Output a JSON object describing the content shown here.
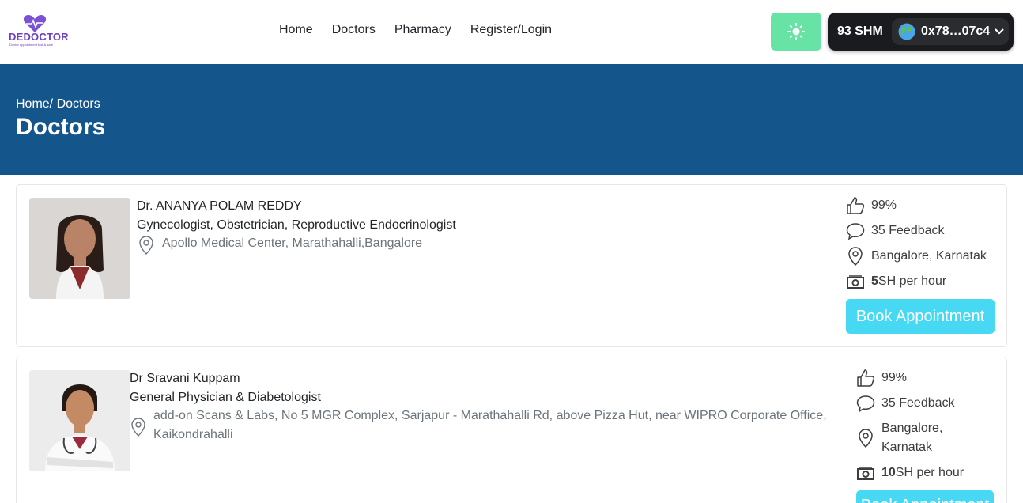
{
  "brand": {
    "name": "DEDOCTOR",
    "tagline": "Doctor appointment fast & safe",
    "accent": "#6b3fc4"
  },
  "nav": {
    "items": [
      {
        "label": "Home"
      },
      {
        "label": "Doctors"
      },
      {
        "label": "Pharmacy"
      },
      {
        "label": "Register/Login"
      }
    ]
  },
  "theme_toggle": {
    "icon": "sun-icon",
    "color": "#66e3a5"
  },
  "wallet": {
    "balance": "93 SHM",
    "address": "0x78…07c4",
    "icon": "globe-icon"
  },
  "hero": {
    "breadcrumb_home": "Home/",
    "breadcrumb_current": " Doctors",
    "title": "Doctors",
    "color": "#14568c"
  },
  "doctors": [
    {
      "name": "Dr. ANANYA POLAM REDDY",
      "specialty": "Gynecologist, Obstetrician, Reproductive Endocrinologist",
      "address": "Apollo Medical Center, Marathahalli,Bangalore",
      "rating": "99%",
      "feedback": "35 Feedback",
      "location": "Bangalore, Karnatak",
      "fee_amount": "5",
      "fee_unit": "SH per hour",
      "book_label": "Book Appointment"
    },
    {
      "name": "Dr Sravani Kuppam",
      "specialty": "General Physician & Diabetologist",
      "address": "add-on Scans & Labs, No 5 MGR Complex, Sarjapur - Marathahalli Rd, above Pizza Hut, near WIPRO Corporate Office, Kaikondrahalli",
      "rating": "99%",
      "feedback": "35 Feedback",
      "location": "Bangalore, Karnatak",
      "fee_amount": "10",
      "fee_unit": "SH per hour",
      "book_label": "Book Appointment"
    }
  ]
}
